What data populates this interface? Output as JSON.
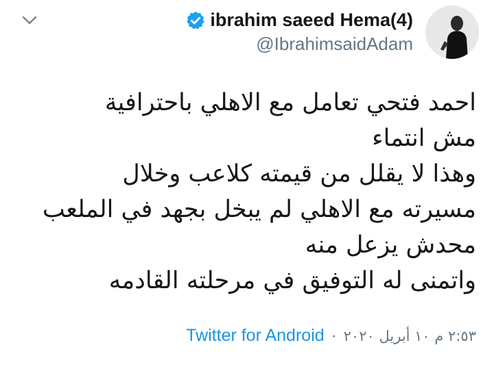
{
  "tweet": {
    "author": {
      "display_name": "ibrahim saeed Hema(4)",
      "handle": "@IbrahimsaidAdam",
      "verified": true
    },
    "menu_icon": "chevron-down-icon",
    "lines": [
      "احمد فتحي تعامل مع الاهلي باحترافية",
      "مش  انتماء",
      "وهذا لا يقلل من قيمته كلاعب وخلال",
      "مسيرته مع الاهلي لم يبخل بجهد في الملعب",
      "محدش يزعل منه",
      "واتمنى له التوفيق في مرحلته القادمه"
    ],
    "timestamp": "٢:٥٣ م ١٠ أبريل ٢٠٢٠",
    "separator": "·",
    "source": "Twitter for Android"
  },
  "colors": {
    "text": "#14171a",
    "secondary": "#657786",
    "link": "#1b95e0",
    "verified_badge": "#1da1f2"
  }
}
